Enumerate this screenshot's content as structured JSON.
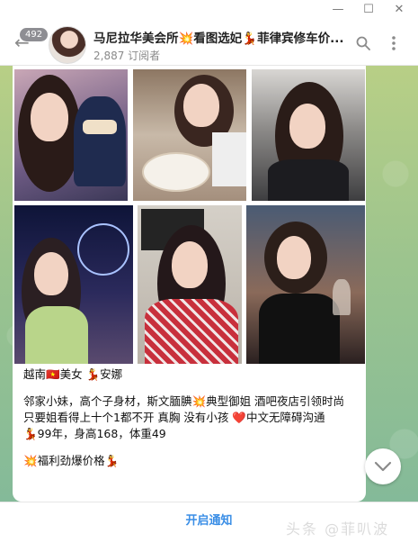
{
  "window": {
    "controls": [
      "minimize",
      "maximize",
      "close"
    ]
  },
  "header": {
    "unread_count": "492",
    "channel_title": "马尼拉华美会所💥看图选妃💃菲律宾修车价...",
    "subscribers": "2,887 订阅者",
    "icons": [
      "back-arrow-icon",
      "search-icon",
      "more-vertical-icon"
    ]
  },
  "message": {
    "line1": "越南🇻🇳美女  💃安娜",
    "paragraph": "邻家小妹，高个子身材，斯文腼腆💥典型御姐 酒吧夜店引领时尚  只要姐看得上十个1都不开  真胸 没有小孩 ❤️中文无障碍沟通",
    "details": "💃99年，身高168，体重49",
    "promo": "💥福利劲爆价格💃"
  },
  "footer": {
    "notify_label": "开启通知"
  },
  "watermark": "头条 @菲叭波"
}
